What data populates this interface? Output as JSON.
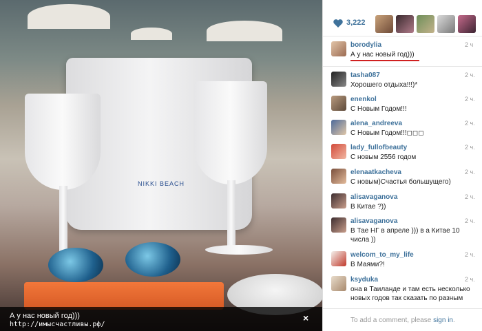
{
  "photo": {
    "caption_line1": "А у нас новый год)))",
    "caption_line2": "http://имысчастливы.рф/",
    "close_label": "×",
    "bucket_logo": "NIKKI BEACH"
  },
  "likes": {
    "count": "3,222",
    "icon": "heart-icon"
  },
  "comments": [
    {
      "user": "borodylia",
      "time": "2 ч",
      "text": "А у нас новый год)))"
    },
    {
      "user": "tasha087",
      "time": "2 ч.",
      "text": "Хорошего отдыха!!!)*"
    },
    {
      "user": "enenkol",
      "time": "2 ч.",
      "text": "С Новым Годом!!!"
    },
    {
      "user": "alena_andreeva",
      "time": "2 ч.",
      "text": "С Новым Годом!!!◻◻◻"
    },
    {
      "user": "lady_fullofbeauty",
      "time": "2 ч.",
      "text": "С новым 2556 годом"
    },
    {
      "user": "elenaatkacheva",
      "time": "2 ч.",
      "text": "С новым)Счастья большущего)"
    },
    {
      "user": "alisavaganova",
      "time": "2 ч.",
      "text": "В Китае ?))"
    },
    {
      "user": "alisavaganova",
      "time": "2 ч.",
      "text": "В Тае НГ в апреле ))) в а Китае 10 числа ))"
    },
    {
      "user": "welcom_to_my_life",
      "time": "2 ч.",
      "text": "В Маями?!"
    },
    {
      "user": "ksyduka",
      "time": "2 ч.",
      "text": "она в Таиланде и там есть несколько новых годов так сказать по разным гороскопам и так далее)"
    }
  ],
  "add_comment": {
    "prefix": "To add a comment, please ",
    "link": "sign in",
    "suffix": "."
  },
  "colors": {
    "link": "#3f729b",
    "highlight": "#d02020"
  }
}
